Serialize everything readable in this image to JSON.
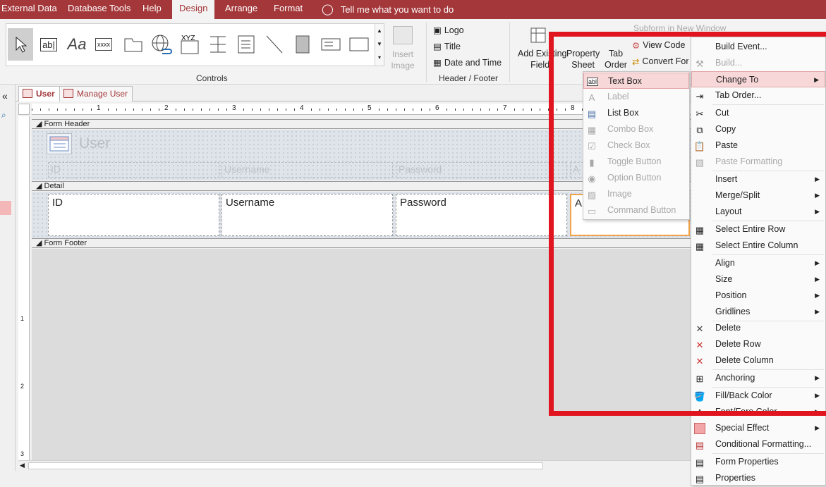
{
  "ribbon_tabs": [
    "External Data",
    "Database Tools",
    "Help",
    "Design",
    "Arrange",
    "Format"
  ],
  "tell_me": "Tell me what you want to do",
  "controls_group": "Controls",
  "insert_image": "Insert Image",
  "header_footer": {
    "items": [
      "Logo",
      "Title",
      "Date and Time"
    ],
    "group": "Header / Footer"
  },
  "tools": {
    "add_existing": [
      "Add Existing",
      "Fields"
    ],
    "property_sheet": [
      "Property",
      "Sheet"
    ],
    "tab_order": [
      "Tab",
      "Order"
    ],
    "subform": "Subform in New Window",
    "view_code": "View Code",
    "convert": "Convert Form's Macros to Visual Basic"
  },
  "doc_tabs": [
    "User",
    "Manage User"
  ],
  "sections": {
    "form_header": "Form Header",
    "detail": "Detail",
    "form_footer": "Form Footer"
  },
  "form_title": "User",
  "header_labels": [
    "ID",
    "Username",
    "Password",
    "A"
  ],
  "detail_fields": [
    "ID",
    "Username",
    "Password",
    "A"
  ],
  "ruler_numbers": [
    "1",
    "2",
    "3",
    "4",
    "5",
    "6",
    "7",
    "8"
  ],
  "vruler_numbers": [
    "1",
    "2",
    "3"
  ],
  "change_to_menu": [
    {
      "label": "Text Box",
      "icon": "textbox-icon",
      "disabled": false,
      "highlighted": true
    },
    {
      "label": "Label",
      "icon": "label-icon",
      "disabled": true
    },
    {
      "label": "List Box",
      "icon": "listbox-icon",
      "disabled": false
    },
    {
      "label": "Combo Box",
      "icon": "combobox-icon",
      "disabled": true
    },
    {
      "label": "Check Box",
      "icon": "checkbox-icon",
      "disabled": true
    },
    {
      "label": "Toggle Button",
      "icon": "toggle-icon",
      "disabled": true
    },
    {
      "label": "Option Button",
      "icon": "option-icon",
      "disabled": true
    },
    {
      "label": "Image",
      "icon": "image-icon",
      "disabled": true
    },
    {
      "label": "Command Button",
      "icon": "command-icon",
      "disabled": true
    }
  ],
  "context_menu": [
    {
      "label": "Build Event...",
      "icon": "",
      "disabled": false,
      "submenu": false
    },
    {
      "label": "Build...",
      "icon": "build-icon",
      "disabled": true,
      "submenu": false
    },
    {
      "label": "Change To",
      "icon": "",
      "disabled": false,
      "submenu": true,
      "highlighted": true
    },
    {
      "label": "Tab Order...",
      "icon": "taborder-icon",
      "disabled": false,
      "submenu": false
    },
    {
      "label": "Cut",
      "icon": "cut-icon",
      "disabled": false,
      "submenu": false
    },
    {
      "label": "Copy",
      "icon": "copy-icon",
      "disabled": false,
      "submenu": false
    },
    {
      "label": "Paste",
      "icon": "paste-icon",
      "disabled": false,
      "submenu": false
    },
    {
      "label": "Paste Formatting",
      "icon": "paste-format-icon",
      "disabled": true,
      "submenu": false
    },
    {
      "label": "Insert",
      "icon": "",
      "disabled": false,
      "submenu": true
    },
    {
      "label": "Merge/Split",
      "icon": "",
      "disabled": false,
      "submenu": true
    },
    {
      "label": "Layout",
      "icon": "",
      "disabled": false,
      "submenu": true
    },
    {
      "label": "Select Entire Row",
      "icon": "grid-icon",
      "disabled": false,
      "submenu": false
    },
    {
      "label": "Select Entire Column",
      "icon": "grid-icon",
      "disabled": false,
      "submenu": false
    },
    {
      "label": "Align",
      "icon": "",
      "disabled": false,
      "submenu": true
    },
    {
      "label": "Size",
      "icon": "",
      "disabled": false,
      "submenu": true
    },
    {
      "label": "Position",
      "icon": "",
      "disabled": false,
      "submenu": true
    },
    {
      "label": "Gridlines",
      "icon": "",
      "disabled": false,
      "submenu": true
    },
    {
      "label": "Delete",
      "icon": "delete-icon",
      "disabled": false,
      "submenu": false
    },
    {
      "label": "Delete Row",
      "icon": "delete-row-icon",
      "disabled": false,
      "submenu": false
    },
    {
      "label": "Delete Column",
      "icon": "delete-column-icon",
      "disabled": false,
      "submenu": false
    },
    {
      "label": "Anchoring",
      "icon": "anchoring-icon",
      "disabled": false,
      "submenu": true
    },
    {
      "label": "Fill/Back Color",
      "icon": "fill-color-icon",
      "disabled": false,
      "submenu": true
    },
    {
      "label": "Font/Fore Color",
      "icon": "font-color-icon",
      "disabled": false,
      "submenu": true
    },
    {
      "label": "Special Effect",
      "icon": "special-effect-icon",
      "disabled": false,
      "submenu": true
    },
    {
      "label": "Conditional Formatting...",
      "icon": "conditional-format-icon",
      "disabled": false,
      "submenu": false
    },
    {
      "label": "Form Properties",
      "icon": "form-properties-icon",
      "disabled": false,
      "submenu": false
    },
    {
      "label": "Properties",
      "icon": "properties-icon",
      "disabled": false,
      "submenu": false
    }
  ],
  "colors": {
    "accent": "#a4373a",
    "highlight": "#f8d7d8",
    "annotation": "#e1151f"
  }
}
